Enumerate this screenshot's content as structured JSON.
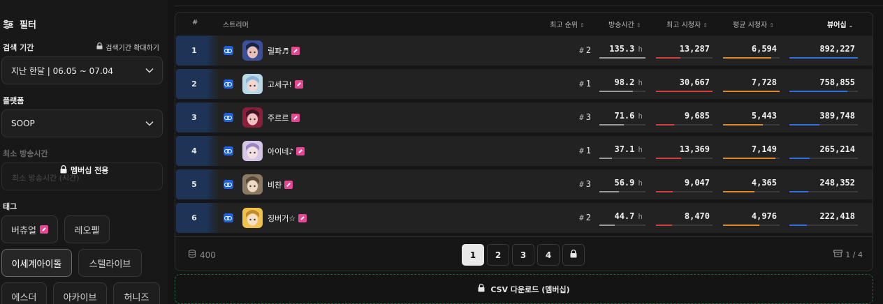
{
  "sidebar": {
    "title": "필터",
    "search_period": {
      "label": "검색 기간",
      "expand_label": "검색기간 확대하기",
      "value": "지난 한달 | 06.05 ~ 07.04"
    },
    "platform": {
      "label": "플랫폼",
      "value": "SOOP"
    },
    "min_broadcast": {
      "label": "최소 방송시간",
      "placeholder": "최소 방송시간 (시간)",
      "lock_label": "멤버십 전용"
    },
    "tags": {
      "label": "태그",
      "items": [
        {
          "label": "버츄얼",
          "badge": true,
          "active": false
        },
        {
          "label": "레오펠",
          "badge": false,
          "active": false
        },
        {
          "label": "이세계아이돌",
          "badge": false,
          "active": true
        },
        {
          "label": "스텔라이브",
          "badge": false,
          "active": false
        },
        {
          "label": "에스더",
          "badge": false,
          "active": false
        },
        {
          "label": "아카이브",
          "badge": false,
          "active": false
        },
        {
          "label": "허니즈",
          "badge": false,
          "active": false
        }
      ]
    }
  },
  "table": {
    "headers": {
      "rank": "#",
      "streamer": "스트리머",
      "peak_rank": "최고 순위",
      "broadcast_time": "방송시간",
      "max_viewers": "최고 시청자",
      "avg_viewers": "평균 시청자",
      "viewership": "뷰어십"
    },
    "colors": {
      "platform": "#1f62d6",
      "badge": "#e84593",
      "broadcast_bar": "#9a9a9a",
      "max_bar": "#d6403a",
      "avg_bar": "#e0892a",
      "viewership_bar": "#2f6fe0"
    },
    "rows": [
      {
        "rank": "1",
        "name": "릴파♬",
        "peak": "2",
        "hours": "135.3",
        "unit": "h",
        "max": "13,287",
        "avg": "6,594",
        "viewership": "892,227",
        "hours_frac": 1.0,
        "max_frac": 0.43,
        "avg_frac": 0.85,
        "view_frac": 1.0,
        "avatar": [
          "#3b4f9a",
          "#e9c1b6",
          "#1c2240"
        ]
      },
      {
        "rank": "2",
        "name": "고세구!",
        "peak": "1",
        "hours": "98.2",
        "unit": "h",
        "max": "30,667",
        "avg": "7,728",
        "viewership": "758,855",
        "hours_frac": 0.73,
        "max_frac": 1.0,
        "avg_frac": 1.0,
        "view_frac": 0.85,
        "avatar": [
          "#b9d8e8",
          "#f1d6d0",
          "#8fb4d6"
        ]
      },
      {
        "rank": "3",
        "name": "주르르",
        "peak": "3",
        "hours": "71.6",
        "unit": "h",
        "max": "9,685",
        "avg": "5,443",
        "viewership": "389,748",
        "hours_frac": 0.53,
        "max_frac": 0.32,
        "avg_frac": 0.7,
        "view_frac": 0.44,
        "avatar": [
          "#8a1f3a",
          "#f0c0c4",
          "#3a1420"
        ]
      },
      {
        "rank": "4",
        "name": "아이네♪",
        "peak": "1",
        "hours": "37.1",
        "unit": "h",
        "max": "13,369",
        "avg": "7,149",
        "viewership": "265,214",
        "hours_frac": 0.27,
        "max_frac": 0.44,
        "avg_frac": 0.92,
        "view_frac": 0.3,
        "avatar": [
          "#d6c6e8",
          "#f4e0e0",
          "#9a86c2"
        ]
      },
      {
        "rank": "5",
        "name": "비챤",
        "peak": "3",
        "hours": "56.9",
        "unit": "h",
        "max": "9,047",
        "avg": "4,365",
        "viewership": "248,352",
        "hours_frac": 0.42,
        "max_frac": 0.3,
        "avg_frac": 0.56,
        "view_frac": 0.28,
        "avatar": [
          "#8c7a62",
          "#efd9c2",
          "#5a4a3a"
        ]
      },
      {
        "rank": "6",
        "name": "징버거☆",
        "peak": "2",
        "hours": "44.7",
        "unit": "h",
        "max": "8,470",
        "avg": "4,976",
        "viewership": "222,418",
        "hours_frac": 0.33,
        "max_frac": 0.28,
        "avg_frac": 0.64,
        "view_frac": 0.25,
        "avatar": [
          "#f0c24a",
          "#f6e0c8",
          "#c28a2a"
        ]
      }
    ]
  },
  "footer": {
    "count": "400",
    "pages": [
      "1",
      "2",
      "3",
      "4"
    ],
    "current_page": "1",
    "page_info": "1 / 4"
  },
  "csv_label": "CSV 다운로드 (멤버십)"
}
